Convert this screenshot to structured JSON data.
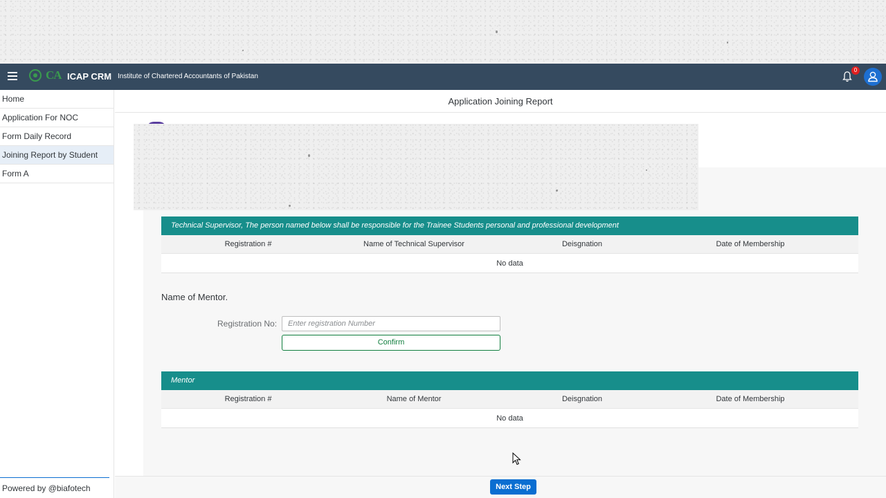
{
  "shellbar": {
    "title": "ICAP CRM",
    "subtitle": "Institute of Chartered Accountants of Pakistan",
    "logo_text": "CA",
    "notification_count": "0"
  },
  "sidebar": {
    "items": [
      {
        "label": "Home"
      },
      {
        "label": "Application For NOC"
      },
      {
        "label": "Form Daily Record"
      },
      {
        "label": "Joining Report by Student",
        "active": true
      },
      {
        "label": "Form A"
      }
    ],
    "footer": "Powered by @biafotech"
  },
  "page": {
    "title": "Application Joining Report"
  },
  "supervisor_table": {
    "caption": "Technical Supervisor, The person named below shall be responsible for the Trainee Students personal and professional development",
    "columns": [
      "Registration #",
      "Name of Technical Supervisor",
      "Deisgnation",
      "Date of Membership"
    ],
    "empty_text": "No data"
  },
  "mentor_form": {
    "title": "Name of Mentor.",
    "reg_label": "Registration No:",
    "reg_placeholder": "Enter registration Number",
    "reg_value": "",
    "confirm_label": "Confirm"
  },
  "mentor_table": {
    "caption": "Mentor",
    "columns": [
      "Registration #",
      "Name of Mentor",
      "Deisgnation",
      "Date of Membership"
    ],
    "empty_text": "No data"
  },
  "footer": {
    "next_label": "Next Step"
  },
  "colors": {
    "shellbar": "#354a5f",
    "teal_header": "#178e8b",
    "primary": "#0a6ed1",
    "confirm": "#107e3e"
  }
}
